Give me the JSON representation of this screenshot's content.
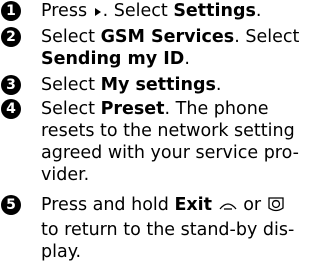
{
  "steps": [
    {
      "number": "1",
      "p1": "Press ",
      "icon1": "right-arrow-key-icon",
      "p2": ". Select ",
      "b1": "Settings",
      "p3": "."
    },
    {
      "number": "2",
      "p1": "Select ",
      "b1": "GSM Services",
      "p2": ". Select",
      "b2": "Sending my ID",
      "p3": "."
    },
    {
      "number": "3",
      "p1": "Select ",
      "b1": "My settings",
      "p2": "."
    },
    {
      "number": "4",
      "p1": "Select ",
      "b1": "Preset",
      "p2": ". The phone",
      "line2": "resets to the network setting",
      "line3": "agreed with your service pro-",
      "line4": "vider."
    },
    {
      "number": "5",
      "p1": "Press and hold ",
      "b1": "Exit",
      "icon1": "end-call-key-icon",
      "p2": " or ",
      "icon2": "phone-key-icon",
      "line2": "to return to the stand-by dis-",
      "line3": "play."
    }
  ]
}
